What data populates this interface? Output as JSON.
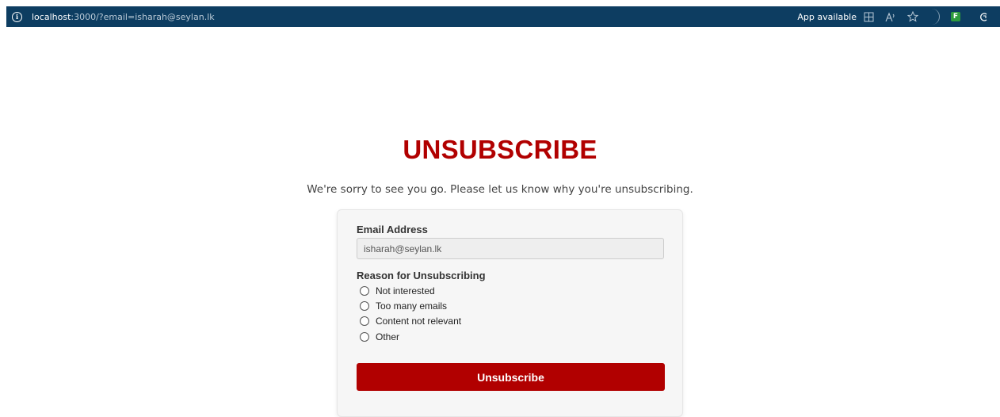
{
  "browser": {
    "url_host": "localhost",
    "url_rest": ":3000/?email=isharah@seylan.lk",
    "app_available": "App available"
  },
  "page": {
    "title": "UNSUBSCRIBE",
    "subtitle": "We're sorry to see you go. Please let us know why you're unsubscribing."
  },
  "form": {
    "email_label": "Email Address",
    "email_value": "isharah@seylan.lk",
    "reason_label": "Reason for Unsubscribing",
    "reasons": [
      "Not interested",
      "Too many emails",
      "Content not relevant",
      "Other"
    ],
    "submit_label": "Unsubscribe"
  },
  "colors": {
    "accent": "#b10000",
    "address_bar": "#0d3d61"
  },
  "icons": [
    "info-icon",
    "app-available-icon",
    "read-aloud-icon",
    "favorite-star-icon",
    "extension-icon",
    "copilot-icon"
  ]
}
